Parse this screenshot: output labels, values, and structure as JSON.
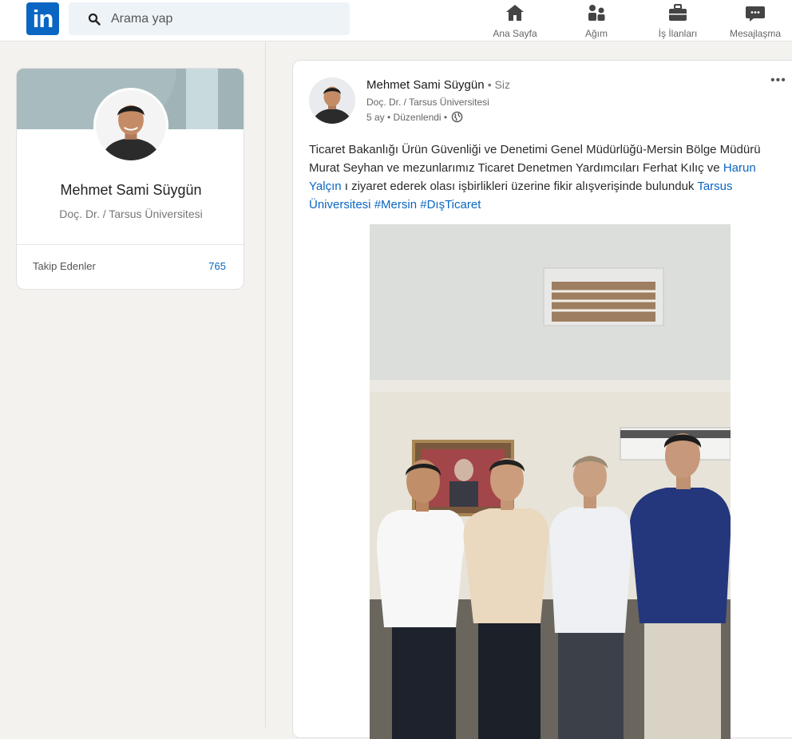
{
  "topbar": {
    "search_placeholder": "Arama yap",
    "nav": [
      {
        "label": "Ana Sayfa",
        "icon": "home-icon"
      },
      {
        "label": "Ağım",
        "icon": "network-icon"
      },
      {
        "label": "İş İlanları",
        "icon": "briefcase-icon"
      },
      {
        "label": "Mesajlaşma",
        "icon": "chat-icon"
      }
    ]
  },
  "profile": {
    "name": "Mehmet Sami Süygün",
    "title": "Doç. Dr. / Tarsus Üniversitesi",
    "followers_label": "Takip Edenler",
    "followers_count": "765"
  },
  "post": {
    "author": "Mehmet Sami Süygün",
    "author_suffix": "• Siz",
    "subtitle": "Doç. Dr. / Tarsus Üniversitesi",
    "meta": "5 ay • Düzenlendi •",
    "text_part1": "Ticaret Bakanlığı Ürün Güvenliği ve Denetimi Genel Müdürlüğü-Mersin Bölge Müdürü Murat Seyhan ve mezunlarımız Ticaret Denetmen Yardımcıları Ferhat Kılıç ve ",
    "mention": "Harun Yalçın",
    "text_part2": " ı ziyaret ederek olası işbirlikleri üzerine fikir alışverişinde bulunduk ",
    "tag_university": "Tarsus Üniversitesi",
    "tag_mersin": "#Mersin",
    "tag_trade": "#DışTicaret"
  },
  "colors": {
    "brand": "#0a66c2",
    "background": "#f3f2ef"
  }
}
